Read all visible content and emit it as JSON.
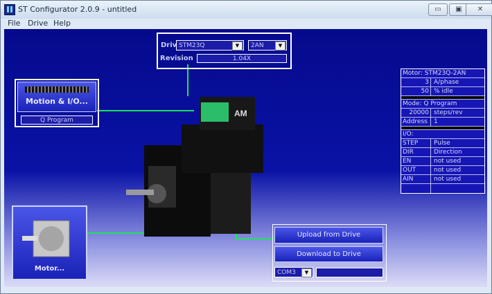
{
  "window": {
    "title": "ST Configurator 2.0.9 - untitled"
  },
  "menu": [
    "File",
    "Drive",
    "Help"
  ],
  "drive_panel": {
    "drive_label": "Drive",
    "drive_model": "STM23Q",
    "drive_variant": "2AN",
    "revision_label": "Revision",
    "revision_value": "1.04X"
  },
  "motion_panel": {
    "button_label": "Motion & I/O...",
    "mode": "Q Program"
  },
  "motor_panel": {
    "button_label": "Motor..."
  },
  "actions": {
    "upload_label": "Upload from Drive",
    "download_label": "Download to Drive",
    "com_port": "COM3",
    "status": ""
  },
  "summary": {
    "motor": "Motor: STM23Q-2AN",
    "current_value": "3",
    "current_unit": "A/phase",
    "idle_value": "50",
    "idle_unit": "% idle",
    "mode": "Mode: Q Program",
    "steps_value": "20000",
    "steps_unit": "steps/rev",
    "address_label": "Address",
    "address_value": "1",
    "io_header": "I/O:",
    "io": [
      {
        "name": "STEP",
        "value": "Pulse"
      },
      {
        "name": "DIR",
        "value": "Direction"
      },
      {
        "name": "EN",
        "value": "not used"
      },
      {
        "name": "OUT",
        "value": "not used"
      },
      {
        "name": "AIN",
        "value": "not used"
      }
    ]
  }
}
